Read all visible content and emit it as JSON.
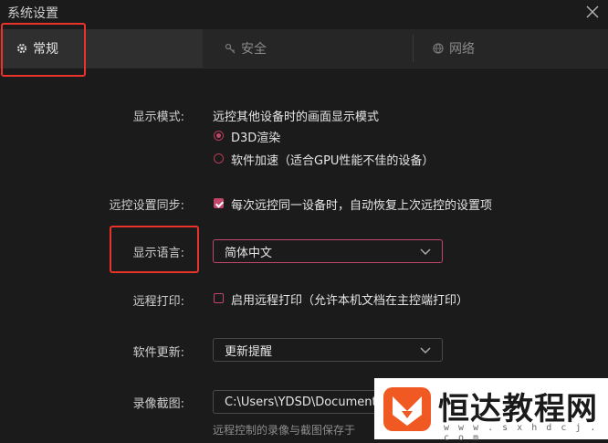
{
  "window": {
    "title": "系统设置"
  },
  "tabs": [
    {
      "label": "常规",
      "icon": "gear-icon",
      "active": true
    },
    {
      "label": "安全",
      "icon": "key-icon",
      "active": false
    },
    {
      "label": "网络",
      "icon": "network-icon",
      "active": false
    }
  ],
  "settings": {
    "display_mode": {
      "label": "显示模式:",
      "description": "远控其他设备时的画面显示模式",
      "options": [
        {
          "label": "D3D渲染",
          "checked": true
        },
        {
          "label": "软件加速（适合GPU性能不佳的设备）",
          "checked": false
        }
      ]
    },
    "sync": {
      "label": "远控设置同步:",
      "checkbox_label": "每次远控同一设备时，自动恢复上次远控的设置项",
      "checked": true
    },
    "language": {
      "label": "显示语言:",
      "value": "简体中文"
    },
    "print": {
      "label": "远程打印:",
      "checkbox_label": "启用远程打印（允许本机文档在主控端打印）",
      "checked": false
    },
    "update": {
      "label": "软件更新:",
      "value": "更新提醒"
    },
    "recording": {
      "label": "录像截图:",
      "path": "C:\\Users\\YDSD\\Documents",
      "hint": "远程控制的录像与截图保存于"
    }
  },
  "watermark": {
    "title": "恒达教程网",
    "url": "w w w . s x h d c j . c o m"
  },
  "colors": {
    "accent": "#c2466a",
    "highlight": "#e8322a",
    "background": "#1b1b1b"
  }
}
